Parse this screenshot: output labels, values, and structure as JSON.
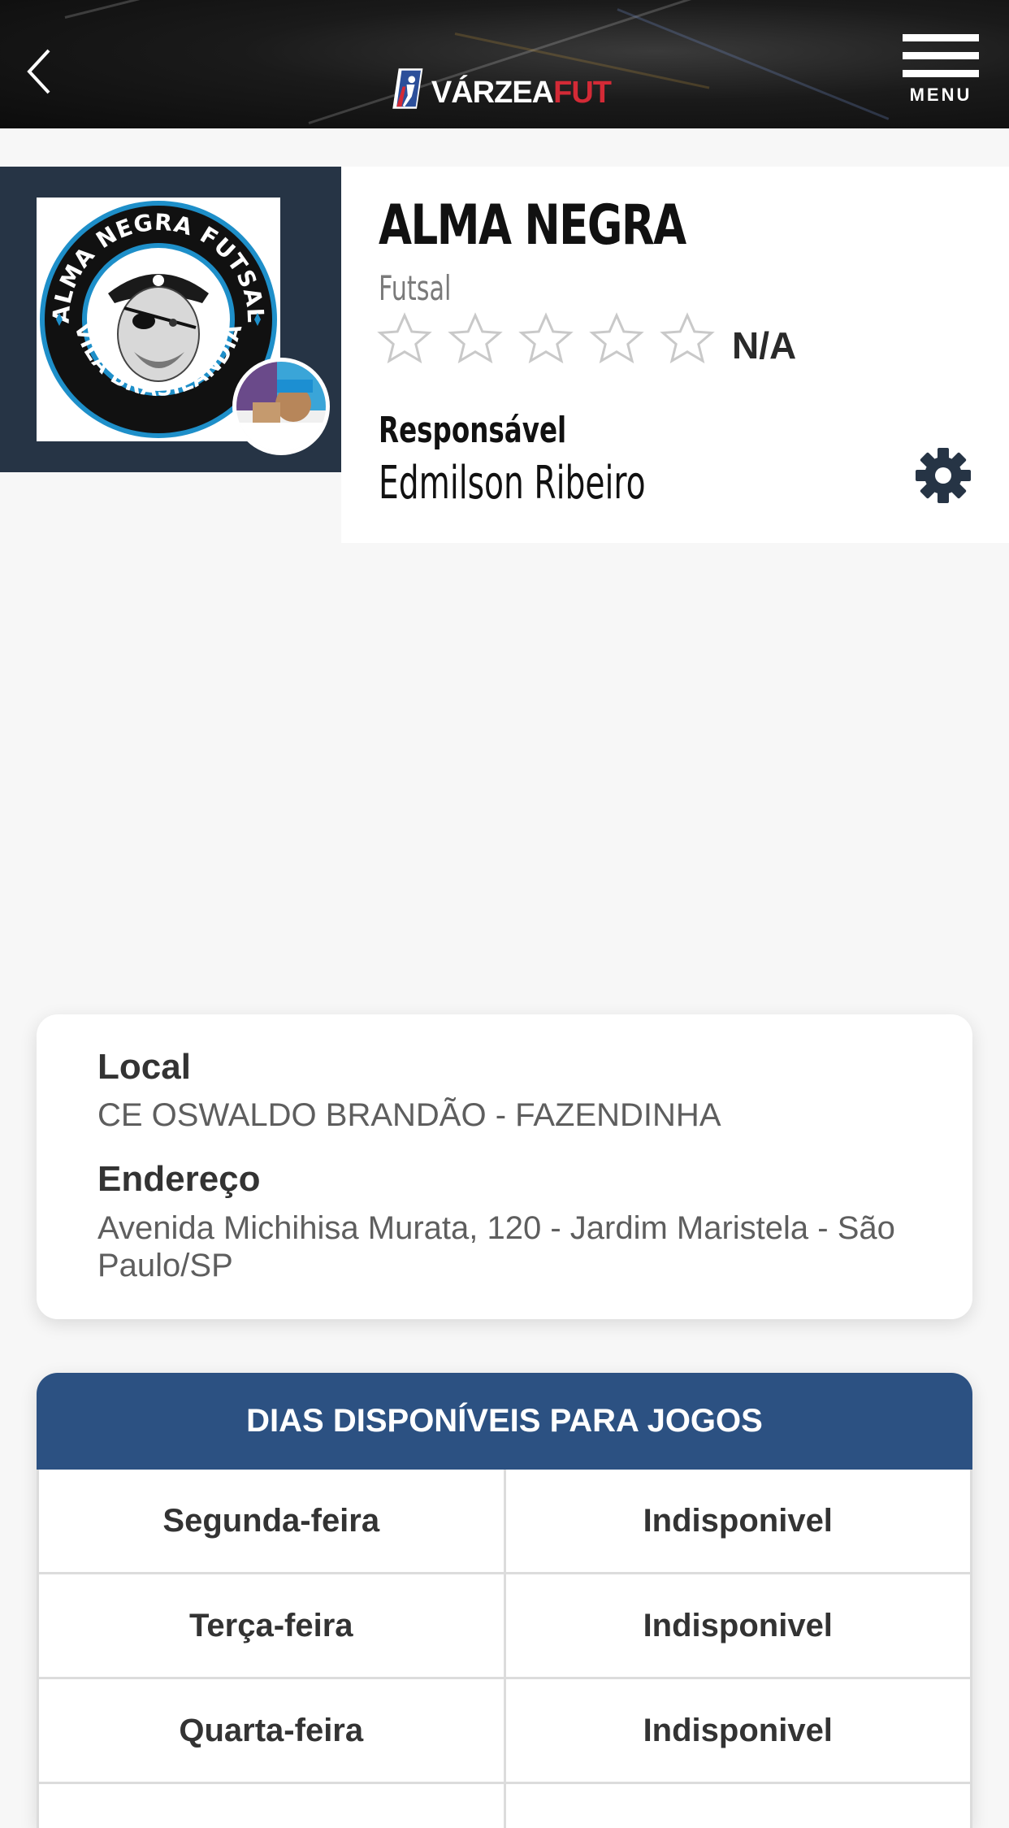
{
  "header": {
    "logo_text_white": "VÁRZEA",
    "logo_text_red": "FUT",
    "menu_label": "MENU",
    "icons": {
      "back": "chevron-left-icon",
      "menu": "hamburger-menu-icon"
    }
  },
  "team": {
    "logo_text_top": "ALMA NEGRA FUTSAL",
    "logo_text_bottom": "VILA BRASILÂNDIA",
    "name": "ALMA NEGRA",
    "sport": "Futsal",
    "rating": {
      "stars_filled": 0,
      "stars_total": 5,
      "text": "N/A"
    },
    "responsible_label": "Responsável",
    "responsible_name": "Edmilson Ribeiro",
    "settings_icon": "gear-icon"
  },
  "location": {
    "local_label": "Local",
    "local_value": "CE OSWALDO BRANDÃO - FAZENDINHA",
    "address_label": "Endereço",
    "address_value": "Avenida Michihisa Murata, 120 - Jardim Maristela - São Paulo/SP"
  },
  "days": {
    "title": "DIAS DISPONÍVEIS PARA JOGOS",
    "rows": [
      {
        "day": "Segunda-feira",
        "status": "Indisponivel"
      },
      {
        "day": "Terça-feira",
        "status": "Indisponivel"
      },
      {
        "day": "Quarta-feira",
        "status": "Indisponivel"
      }
    ]
  },
  "colors": {
    "header_bg": "#111111",
    "team_panel": "#263445",
    "days_header": "#2c5182",
    "brand_red": "#d32a36"
  }
}
